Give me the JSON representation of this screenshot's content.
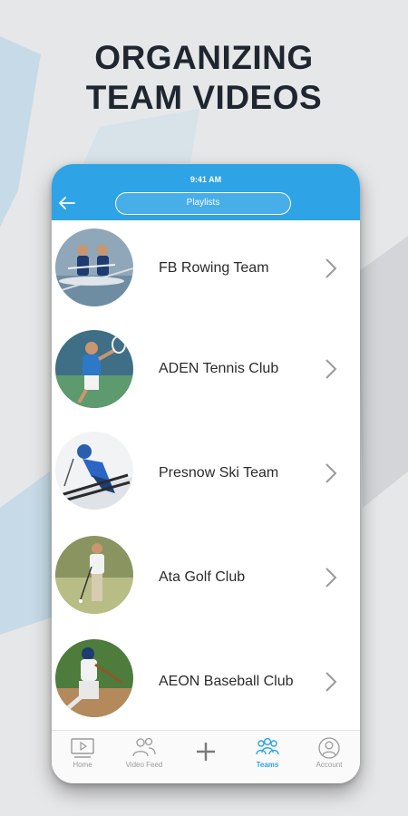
{
  "headline": {
    "line1": "ORGANIZING",
    "line2": "TEAM VIDEOS"
  },
  "status_bar": {
    "time": "9:41 AM"
  },
  "header": {
    "back_icon": "arrow-left-icon",
    "pill_label": "Playlists"
  },
  "teams": [
    {
      "name": "FB Rowing Team",
      "image": "rowing-photo"
    },
    {
      "name": "ADEN Tennis Club",
      "image": "tennis-photo"
    },
    {
      "name": "Presnow Ski Team",
      "image": "ski-photo"
    },
    {
      "name": "Ata Golf Club",
      "image": "golf-photo"
    },
    {
      "name": "AEON Baseball Club",
      "image": "baseball-photo"
    }
  ],
  "tabs": [
    {
      "label": "Home",
      "icon": "video-screen-icon",
      "active": false
    },
    {
      "label": "Video Feed",
      "icon": "users-icon",
      "active": false
    },
    {
      "label": "",
      "icon": "plus-icon",
      "active": false
    },
    {
      "label": "Teams",
      "icon": "team-group-icon",
      "active": true
    },
    {
      "label": "Account",
      "icon": "user-circle-icon",
      "active": false
    }
  ],
  "colors": {
    "accent": "#2ea3e6",
    "background": "#e6e7e8",
    "headline": "#1f2630"
  }
}
